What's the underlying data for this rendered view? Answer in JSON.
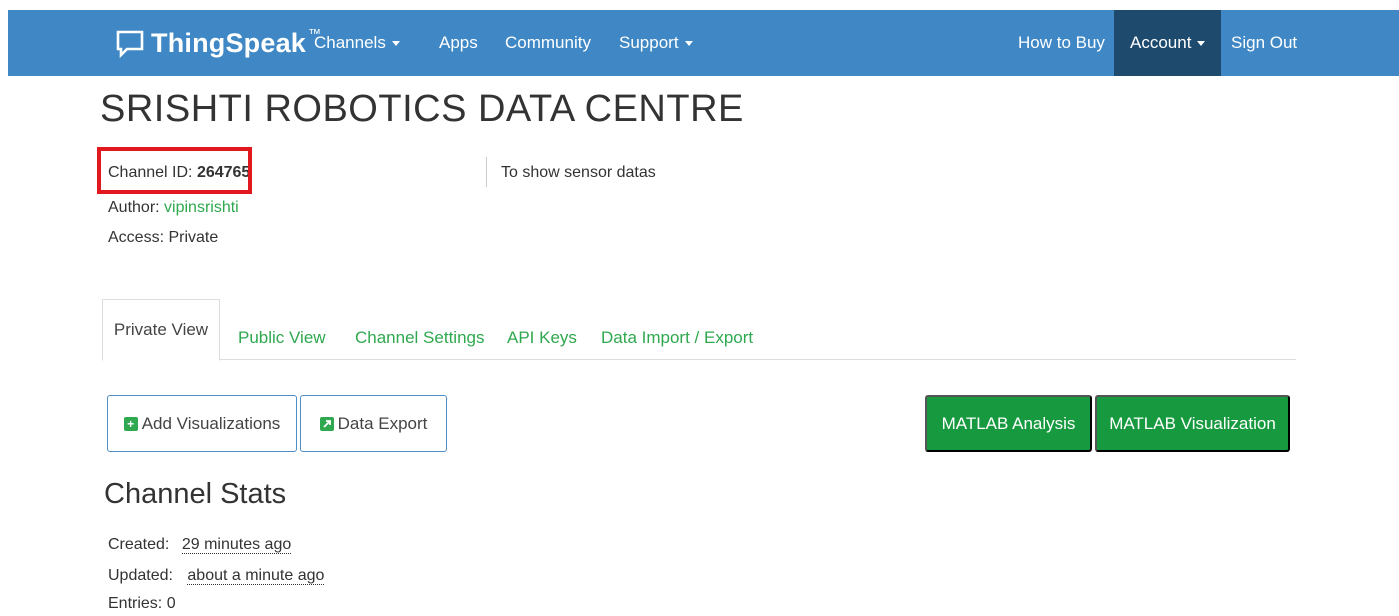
{
  "navbar": {
    "brand": "ThingSpeak",
    "brand_tm": "™",
    "brand_icon": "chat-bubble-icon",
    "items": [
      {
        "label": "Channels",
        "has_caret": true
      },
      {
        "label": "Apps",
        "has_caret": false
      },
      {
        "label": "Community",
        "has_caret": false
      },
      {
        "label": "Support",
        "has_caret": true
      }
    ],
    "right_items": [
      {
        "label": "How to Buy"
      },
      {
        "label": "Account",
        "has_caret": true,
        "active": true
      },
      {
        "label": "Sign Out"
      }
    ],
    "colors": {
      "bar": "#3f88c5",
      "active": "#1e4a6e"
    }
  },
  "channel": {
    "title": "SRISHTI ROBOTICS DATA CENTRE",
    "id_label": "Channel ID: ",
    "id_value": "264765",
    "author_label": "Author: ",
    "author_value": "vipinsrishti",
    "access_label": "Access: ",
    "access_value": "Private",
    "description": "To show sensor datas"
  },
  "tabs": [
    {
      "label": "Private View",
      "active": true
    },
    {
      "label": "Public View"
    },
    {
      "label": "Channel Settings"
    },
    {
      "label": "API Keys"
    },
    {
      "label": "Data Import / Export"
    }
  ],
  "buttons": {
    "add_visualizations": "Add Visualizations",
    "add_visualizations_icon": "plus-square-icon",
    "data_export": "Data Export",
    "data_export_icon": "external-link-square-icon",
    "matlab_analysis": "MATLAB Analysis",
    "matlab_visualization": "MATLAB Visualization"
  },
  "stats": {
    "title": "Channel Stats",
    "created_label": "Created:",
    "created_value": "29 minutes ago",
    "updated_label": "Updated:",
    "updated_value": "about a minute ago",
    "entries_label": "Entries: ",
    "entries_value": "0"
  },
  "colors": {
    "link_green": "#2fa84f",
    "button_green": "#179a3f",
    "highlight_red": "#e0191f"
  }
}
